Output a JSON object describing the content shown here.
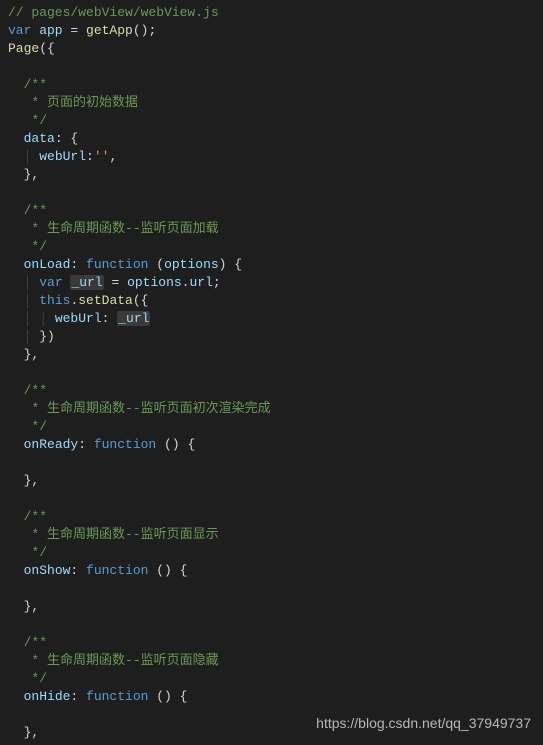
{
  "filecomment": "// pages/webView/webView.js",
  "line_var_app": {
    "kw": "var",
    "ident": " app ",
    "op": "= ",
    "fn": "getApp",
    "tail": "();"
  },
  "line_page_open": {
    "fn": "Page",
    "tail": "({"
  },
  "blocks": {
    "data": {
      "c1": "/**",
      "c2": " * 页面的初始数据",
      "c3": " */",
      "key": "data",
      "open": ": {",
      "prop": "webUrl",
      "colon": ":",
      "val": "''",
      "comma": ",",
      "close": "},"
    },
    "onLoad": {
      "c1": "/**",
      "c2": " * 生命周期函数--监听页面加载",
      "c3": " */",
      "key": "onLoad",
      "kw": "function",
      "params_open": " (",
      "param": "options",
      "params_close": ") {",
      "l1_kw": "var",
      "l1_id": "_url",
      "l1_mid": " = ",
      "l1_obj": "options",
      "l1_dot": ".",
      "l1_prop": "url",
      "l1_end": ";",
      "l2_this": "this",
      "l2_dot": ".",
      "l2_fn": "setData",
      "l2_tail": "({",
      "l3_key": "webUrl",
      "l3_colon": ": ",
      "l3_val": "_url",
      "l4": "})",
      "close": "},"
    },
    "onReady": {
      "c1": "/**",
      "c2": " * 生命周期函数--监听页面初次渲染完成",
      "c3": " */",
      "key": "onReady",
      "kw": "function",
      "params": " () {",
      "close": "},"
    },
    "onShow": {
      "c1": "/**",
      "c2": " * 生命周期函数--监听页面显示",
      "c3": " */",
      "key": "onShow",
      "kw": "function",
      "params": " () {",
      "close": "},"
    },
    "onHide": {
      "c1": "/**",
      "c2": " * 生命周期函数--监听页面隐藏",
      "c3": " */",
      "key": "onHide",
      "kw": "function",
      "params": " () {",
      "close": "},"
    }
  },
  "watermark": "https://blog.csdn.net/qq_37949737"
}
